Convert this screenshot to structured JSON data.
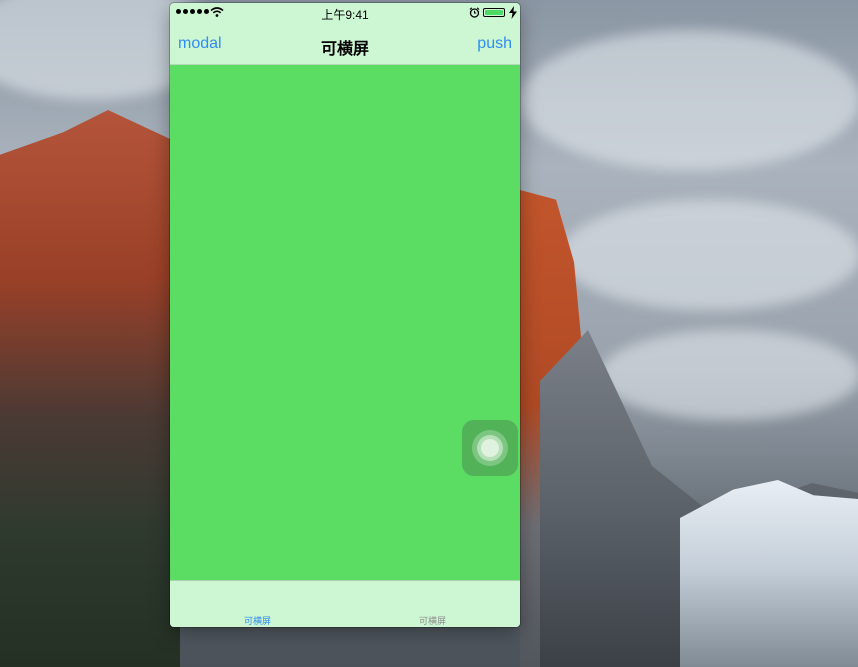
{
  "status_bar": {
    "time": "上午9:41",
    "signal_icon": "signal-dots-icon",
    "wifi_icon": "wifi-icon",
    "alarm_icon": "alarm-icon",
    "battery_icon": "battery-icon",
    "charging_icon": "charging-bolt-icon",
    "battery_level": 1.0
  },
  "nav_bar": {
    "left_button": "modal",
    "title": "可横屏",
    "right_button": "push"
  },
  "tab_bar": {
    "tabs": [
      {
        "label": "可横屏",
        "selected": true
      },
      {
        "label": "可横屏",
        "selected": false
      }
    ]
  },
  "colors": {
    "content_background": "#5bdc63",
    "bar_background": "#cdf6d2",
    "tint": "#2f8cf2"
  },
  "assistive_touch": {
    "icon": "assistive-touch-icon"
  }
}
